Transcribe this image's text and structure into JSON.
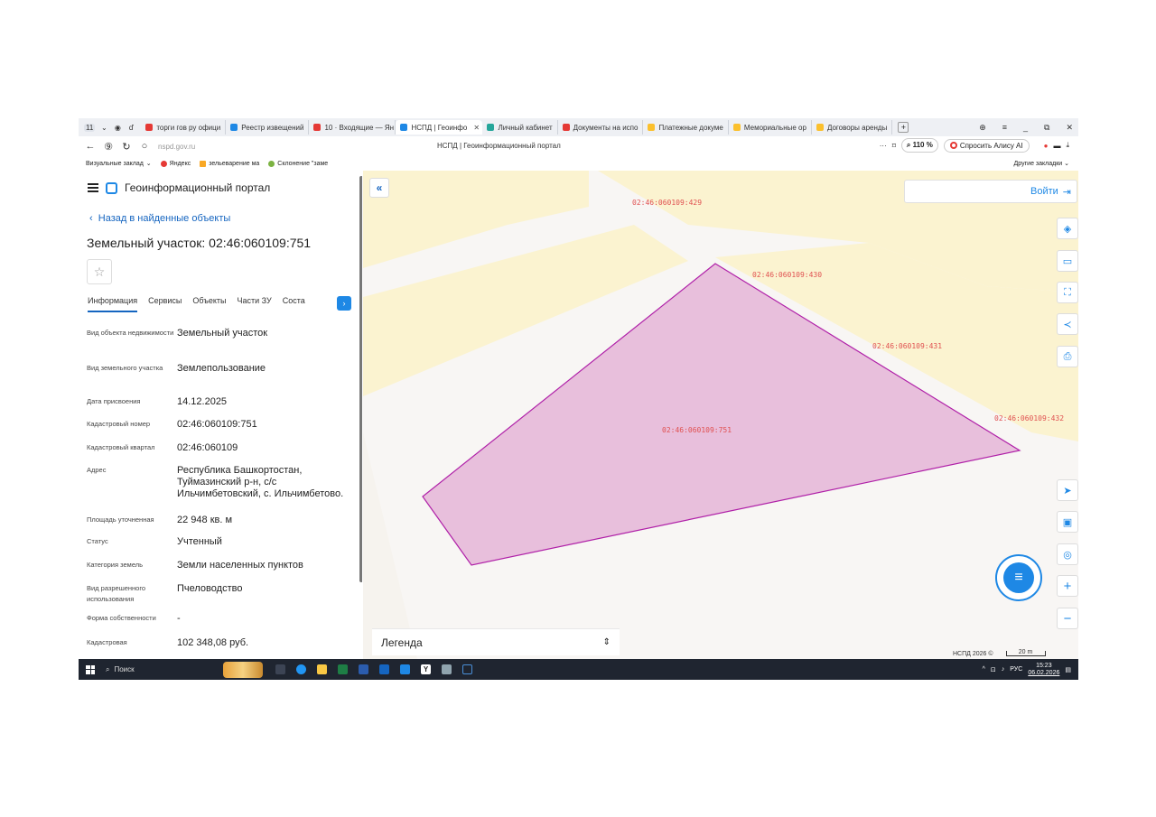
{
  "browser": {
    "tab_count": "11",
    "tabs": [
      {
        "label": "торги гов ру офици",
        "color": "#e53935"
      },
      {
        "label": "Реестр извещений",
        "color": "#1e88e5"
      },
      {
        "label": "10 · Входящие — Ян",
        "color": "#e53935"
      },
      {
        "label": "НСПД | Геоинфо",
        "color": "#1e88e5",
        "active": true
      },
      {
        "label": "Личный кабинет",
        "color": "#26a69a"
      },
      {
        "label": "Документы на испо",
        "color": "#e53935"
      },
      {
        "label": "Платежные докуме",
        "color": "#fbc02d"
      },
      {
        "label": "Мемориальные ор",
        "color": "#fbc02d"
      },
      {
        "label": "Договоры аренды",
        "color": "#fbc02d"
      }
    ],
    "url": "nspd.gov.ru",
    "page_title": "НСПД | Геоинформационный портал",
    "zoom": "110 %",
    "alice_label": "Спросить Алису AI",
    "bookmarks": [
      "Визуальные заклад",
      "Яндекс",
      "зельеварение ма",
      "Склонение \"заме"
    ],
    "bookmarks_right": "Другие закладки"
  },
  "panel": {
    "portal_name": "Геоинформационный портал",
    "back_label": "Назад в найденные объекты",
    "title": "Земельный участок: 02:46:060109:751",
    "tabs": [
      "Информация",
      "Сервисы",
      "Объекты",
      "Части ЗУ",
      "Соста"
    ],
    "props": [
      {
        "k": "Вид объекта недвижимости",
        "v": "Земельный участок"
      },
      {
        "k": "Вид земельного участка",
        "v": "Землепользование"
      },
      {
        "k": "Дата присвоения",
        "v": "14.12.2025"
      },
      {
        "k": "Кадастровый номер",
        "v": "02:46:060109:751"
      },
      {
        "k": "Кадастровый квартал",
        "v": "02:46:060109"
      },
      {
        "k": "Адрес",
        "v": "Республика Башкортостан, Туймазинский р-н, с/с Ильчимбетовский, с. Ильчимбетово."
      },
      {
        "k": "Площадь уточненная",
        "v": "22 948 кв. м"
      },
      {
        "k": "Статус",
        "v": "Учтенный"
      },
      {
        "k": "Категория земель",
        "v": "Земли населенных пунктов"
      },
      {
        "k": "Вид разрешенного использования",
        "v": "Пчеловодство"
      },
      {
        "k": "Форма собственности",
        "v": "-"
      },
      {
        "k": "Кадастровая",
        "v": "102 348,08 руб."
      }
    ]
  },
  "map": {
    "login_label": "Войти",
    "parcel_labels": [
      "02:46:060109:429",
      "02:46:060109:430",
      "02:46:060109:431",
      "02:46:060109:432",
      "02:46:060109:751"
    ],
    "legend_label": "Легенда",
    "copyright": "НСПД 2026 ©",
    "scale": "20 m",
    "parcel_color": "#e8bfdc",
    "parcel_stroke": "#b020a8"
  },
  "taskbar": {
    "search_label": "Поиск",
    "lang": "РУС",
    "time": "15:23",
    "date": "06.02.2026"
  }
}
